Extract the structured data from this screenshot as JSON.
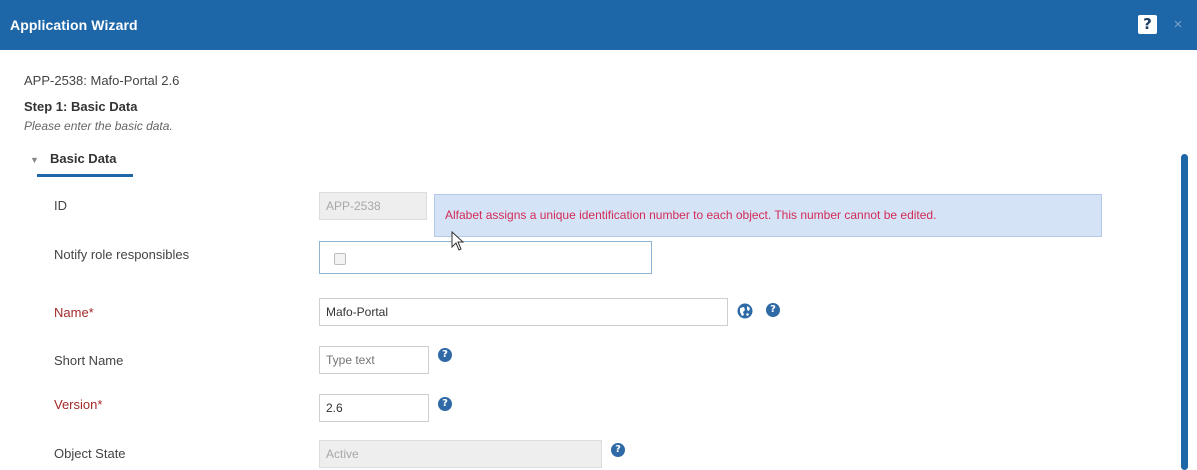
{
  "window": {
    "title": "Application Wizard",
    "help_label": "?",
    "close_label": "×"
  },
  "header": {
    "record_title": "APP-2538: Mafo-Portal 2.6",
    "step_title": "Step 1: Basic Data",
    "step_description": "Please enter the basic data."
  },
  "section": {
    "label": "Basic Data",
    "expanded": true
  },
  "fields": {
    "id": {
      "label": "ID",
      "value": "APP-2538",
      "disabled": true
    },
    "notify": {
      "label": "Notify role responsibles",
      "checked": false
    },
    "name": {
      "label": "Name*",
      "value": "Mafo-Portal",
      "required": true
    },
    "short_name": {
      "label": "Short Name",
      "value": "",
      "placeholder": "Type text"
    },
    "version": {
      "label": "Version*",
      "value": "2.6",
      "required": true
    },
    "object_state": {
      "label": "Object State",
      "value": "Active",
      "disabled": true
    }
  },
  "tooltip": {
    "text": "Alfabet assigns a unique identification number to each object. This number cannot be edited."
  },
  "icons": {
    "help": "question-circle-icon",
    "globe": "globe-icon",
    "section_toggle": "triangle-down-icon"
  },
  "colors": {
    "titlebar": "#1d66a8",
    "required_label": "#a32a2a",
    "tooltip_bg": "#d5e3f7",
    "tooltip_text": "#d32b56"
  }
}
